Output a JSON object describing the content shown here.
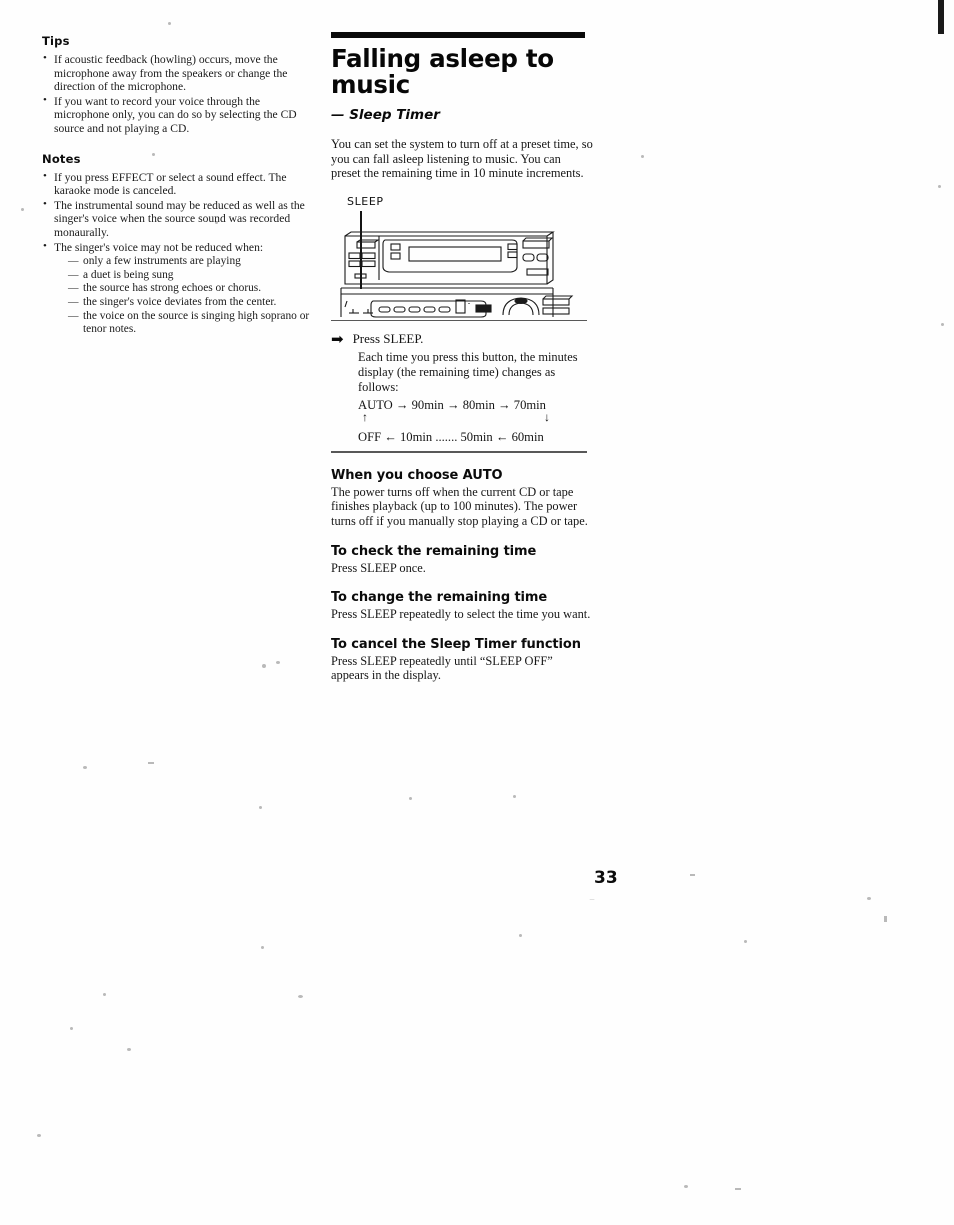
{
  "page": {
    "number": "33"
  },
  "left_column": {
    "tips": {
      "heading": "Tips",
      "items": [
        "If acoustic feedback (howling) occurs, move the microphone away from the speakers or change the direction of the microphone.",
        "If you want to record your voice through the microphone only, you can do so by selecting the CD source and not playing a CD."
      ]
    },
    "notes": {
      "heading": "Notes",
      "items": [
        "If you press EFFECT or select a sound effect. The karaoke mode is canceled.",
        "The instrumental sound may be reduced as well as the singer's voice when the source sound was recorded monaurally.",
        "The singer's voice may not be reduced when:"
      ],
      "sub_items": [
        "only a few instruments are playing",
        "a duet is being sung",
        "the source has strong echoes or chorus.",
        "the singer's voice deviates from the center.",
        "the voice on the source is singing high soprano or tenor notes."
      ]
    }
  },
  "right_column": {
    "title": "Falling asleep to music",
    "subtitle": "— Sleep Timer",
    "intro": "You can set the system to turn off at a preset time, so you can fall asleep listening to music. You can preset the remaining time in 10 minute increments.",
    "illustration": {
      "callout_label": "SLEEP",
      "description": "Front panel of the stereo system with the SLEEP button indicated"
    },
    "step": {
      "arrow": "➡",
      "instruction": "Press SLEEP.",
      "explanation": "Each time you press this button, the minutes display (the remaining time) changes as follows:",
      "cycle_top": "AUTO → 90min → 80min → 70min",
      "cycle_bottom": "OFF ← 10min ....... 50min ← 60min",
      "arrow_up": "↑",
      "arrow_down": "↓"
    },
    "sections": [
      {
        "heading": "When you choose AUTO",
        "body": "The power turns off when the current CD or tape finishes playback (up to 100 minutes). The power turns off if you manually stop playing a CD or tape."
      },
      {
        "heading": "To check the remaining time",
        "body": "Press SLEEP once."
      },
      {
        "heading": "To change the remaining time",
        "body": "Press SLEEP repeatedly to select the time you want."
      },
      {
        "heading": "To cancel the Sleep Timer function",
        "body": "Press SLEEP repeatedly until “SLEEP OFF” appears in the display."
      }
    ]
  }
}
